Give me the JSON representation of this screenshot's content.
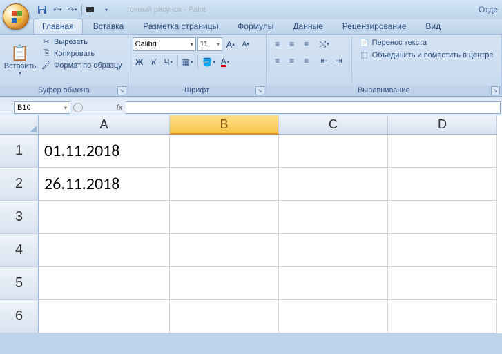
{
  "titlebar": {
    "title_faded": "точный рисунок - Paint",
    "right_text": "Отде"
  },
  "tabs": [
    {
      "label": "Главная",
      "active": true
    },
    {
      "label": "Вставка"
    },
    {
      "label": "Разметка страницы"
    },
    {
      "label": "Формулы"
    },
    {
      "label": "Данные"
    },
    {
      "label": "Рецензирование"
    },
    {
      "label": "Вид"
    }
  ],
  "ribbon": {
    "clipboard": {
      "title": "Буфер обмена",
      "paste": "Вставить",
      "cut": "Вырезать",
      "copy": "Копировать",
      "format_painter": "Формат по образцу"
    },
    "font": {
      "title": "Шрифт",
      "name": "Calibri",
      "size": "11",
      "bold": "Ж",
      "italic": "К",
      "underline": "Ч"
    },
    "alignment": {
      "title": "Выравнивание",
      "wrap": "Перенос текста",
      "merge": "Объединить и поместить в центре"
    }
  },
  "formula_bar": {
    "cell_ref": "B10",
    "fx": "fx",
    "value": ""
  },
  "grid": {
    "columns": [
      "A",
      "B",
      "C",
      "D"
    ],
    "selected_col": "B",
    "rows": [
      "1",
      "2",
      "3",
      "4",
      "5",
      "6"
    ],
    "cells": {
      "A1": "01.11.2018",
      "A2": "26.11.2018"
    }
  }
}
